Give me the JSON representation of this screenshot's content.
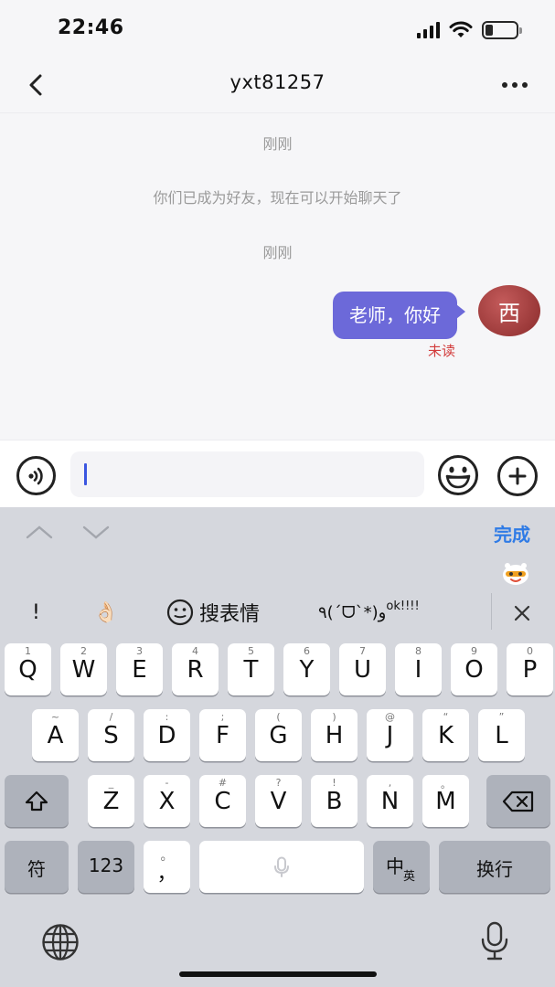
{
  "status_bar": {
    "time": "22:46",
    "battery_level": 0.25
  },
  "nav": {
    "title": "yxt81257"
  },
  "chat": {
    "time_1": "刚刚",
    "system_message": "你们已成为好友，现在可以开始聊天了",
    "time_2": "刚刚",
    "message": "老师，你好",
    "avatar_text": "西",
    "read_status": "未读"
  },
  "keyboard": {
    "done_label": "完成",
    "suggestions": [
      "!",
      "👌🏻",
      "搜表情",
      "٩(ˊᗜˋ*)و"
    ],
    "suggestion_ok": "ok!!!!",
    "row1": [
      {
        "k": "Q",
        "h": "1"
      },
      {
        "k": "W",
        "h": "2"
      },
      {
        "k": "E",
        "h": "3"
      },
      {
        "k": "R",
        "h": "4"
      },
      {
        "k": "T",
        "h": "5"
      },
      {
        "k": "Y",
        "h": "6"
      },
      {
        "k": "U",
        "h": "7"
      },
      {
        "k": "I",
        "h": "8"
      },
      {
        "k": "O",
        "h": "9"
      },
      {
        "k": "P",
        "h": "0"
      }
    ],
    "row2": [
      {
        "k": "A",
        "h": "~"
      },
      {
        "k": "S",
        "h": "/"
      },
      {
        "k": "D",
        "h": ":"
      },
      {
        "k": "F",
        "h": ";"
      },
      {
        "k": "G",
        "h": "("
      },
      {
        "k": "H",
        "h": ")"
      },
      {
        "k": "J",
        "h": "@"
      },
      {
        "k": "K",
        "h": "“"
      },
      {
        "k": "L",
        "h": "”"
      }
    ],
    "row3": [
      {
        "k": "Z",
        "h": "_"
      },
      {
        "k": "X",
        "h": "-"
      },
      {
        "k": "C",
        "h": "#"
      },
      {
        "k": "V",
        "h": "?"
      },
      {
        "k": "B",
        "h": "!"
      },
      {
        "k": "N",
        "h": ","
      },
      {
        "k": "M",
        "h": "。"
      }
    ],
    "symbol_key": "符",
    "numbers_key": "123",
    "punct_key": "，",
    "punct_hint": "。",
    "lang_key_main": "中",
    "lang_key_sub": "英",
    "return_key": "换行"
  }
}
